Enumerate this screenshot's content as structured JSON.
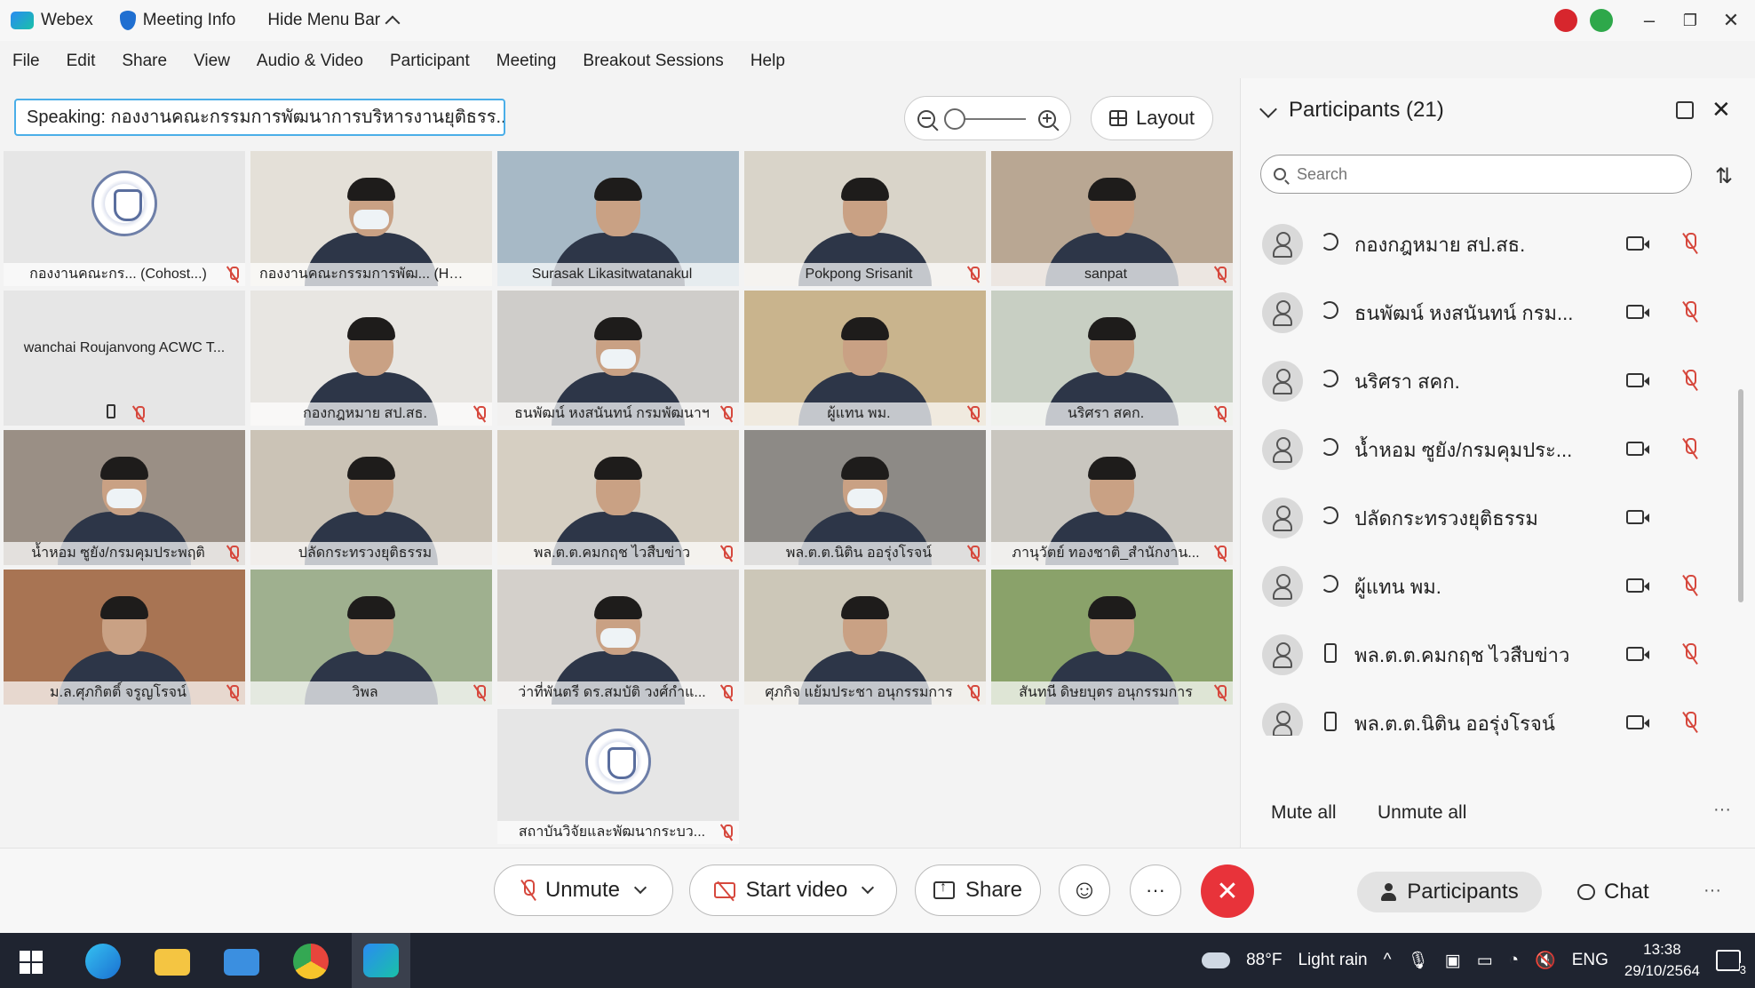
{
  "titlebar": {
    "app_name": "Webex",
    "meeting_info": "Meeting Info",
    "hide_menu": "Hide Menu Bar",
    "status_red_color": "#d7262d",
    "status_green_color": "#2ea84a"
  },
  "menu": [
    "File",
    "Edit",
    "Share",
    "View",
    "Audio & Video",
    "Participant",
    "Meeting",
    "Breakout Sessions",
    "Help"
  ],
  "speaking": "Speaking: กองงานคณะกรรมการพัฒนาการบริหารงานยุติธรร...",
  "zoom_level": 0.05,
  "layout_label": "Layout",
  "tiles": [
    {
      "name": "กองงานคณะกร...   (Cohost...)",
      "type": "seal",
      "muted": true,
      "active": false
    },
    {
      "name": "กองงานคณะกรรมการพัฒ...  (Host)",
      "type": "video",
      "muted": false,
      "active": true,
      "mask": true,
      "bg": "#e4e0d8"
    },
    {
      "name": "Surasak Likasitwatanakul",
      "type": "video",
      "muted": false,
      "active": true,
      "mask": false,
      "bg": "#a7b9c6"
    },
    {
      "name": "Pokpong Srisanit",
      "type": "video",
      "muted": true,
      "active": false,
      "mask": false,
      "bg": "#d9d4c9"
    },
    {
      "name": "sanpat",
      "type": "video",
      "muted": true,
      "active": false,
      "mask": false,
      "bg": "#b9a793"
    },
    {
      "name": "wanchai Roujanvong ACWC T...",
      "type": "text",
      "muted": true,
      "active": false,
      "phone": true
    },
    {
      "name": "กองกฎหมาย สป.สธ.",
      "type": "video",
      "muted": true,
      "active": false,
      "mask": false,
      "bg": "#e8e6e2"
    },
    {
      "name": "ธนพัฒน์ หงสนันทน์ กรมพัฒนาฯ",
      "type": "video",
      "muted": true,
      "active": false,
      "mask": true,
      "bg": "#cfcdca"
    },
    {
      "name": "ผู้แทน พม.",
      "type": "video",
      "muted": true,
      "active": false,
      "mask": false,
      "bg": "#c9b48d"
    },
    {
      "name": "นริศรา สคก.",
      "type": "video",
      "muted": true,
      "active": false,
      "mask": false,
      "bg": "#c8cfc3"
    },
    {
      "name": "น้ำหอม ซูยัง/กรมคุมประพฤติ",
      "type": "video",
      "muted": true,
      "active": false,
      "mask": true,
      "bg": "#9a8f85"
    },
    {
      "name": "ปลัดกระทรวงยุติธรรม",
      "type": "video",
      "muted": false,
      "active": false,
      "mask": false,
      "bg": "#cbc3b6"
    },
    {
      "name": "พล.ต.ต.คมกฤช ไวสืบข่าว",
      "type": "video",
      "muted": true,
      "active": false,
      "mask": false,
      "bg": "#d6cfc2"
    },
    {
      "name": "พล.ต.ต.นิติน ออรุ่งโรจน์",
      "type": "video",
      "muted": true,
      "active": false,
      "mask": true,
      "bg": "#8d8a86"
    },
    {
      "name": "ภานุวัตย์ ทองชาติ_สำนักงาน...",
      "type": "video",
      "muted": true,
      "active": false,
      "mask": false,
      "bg": "#c9c6bf"
    },
    {
      "name": "ม.ล.ศุภกิตติ์ จรูญโรจน์",
      "type": "video",
      "muted": true,
      "active": false,
      "mask": false,
      "bg": "#a87453"
    },
    {
      "name": "วิพล",
      "type": "video",
      "muted": true,
      "active": false,
      "mask": false,
      "bg": "#9fb08f"
    },
    {
      "name": "ว่าที่พันตรี ดร.สมบัติ วงศ์กำแ...",
      "type": "video",
      "muted": true,
      "active": false,
      "mask": true,
      "bg": "#d4d0cb"
    },
    {
      "name": "ศุภกิจ แย้มประชา อนุกรรมการ",
      "type": "video",
      "muted": true,
      "active": false,
      "mask": false,
      "bg": "#ccc7b8"
    },
    {
      "name": "สันทนี ดิษยบุตร อนุกรรมการ",
      "type": "video",
      "muted": true,
      "active": false,
      "mask": false,
      "bg": "#8aa26a"
    },
    {
      "name": "สถาบันวิจัยและพัฒนากระบว...",
      "type": "seal",
      "muted": true,
      "active": false
    }
  ],
  "panel": {
    "title": "Participants (21)",
    "search_placeholder": "Search",
    "mute_all": "Mute all",
    "unmute_all": "Unmute all",
    "more": "···",
    "participants": [
      {
        "name": "กองกฎหมาย สป.สธ.",
        "device": "sync",
        "muted": true
      },
      {
        "name": "ธนพัฒน์ หงสนันทน์ กรม...",
        "device": "sync",
        "muted": true
      },
      {
        "name": "นริศรา สคก.",
        "device": "sync",
        "muted": true
      },
      {
        "name": "น้ำหอม ซูยัง/กรมคุมประ...",
        "device": "sync",
        "muted": true
      },
      {
        "name": "ปลัดกระทรวงยุติธรรม",
        "device": "sync",
        "muted": false
      },
      {
        "name": "ผู้แทน พม.",
        "device": "sync",
        "muted": true
      },
      {
        "name": "พล.ต.ต.คมกฤช ไวสืบข่าว",
        "device": "phone",
        "muted": true
      },
      {
        "name": "พล.ต.ต.นิติน ออรุ่งโรจน์",
        "device": "phone",
        "muted": true
      }
    ]
  },
  "toolbar": {
    "unmute": "Unmute",
    "start_video": "Start video",
    "share": "Share",
    "reactions": "☺",
    "more": "···",
    "end": "✕",
    "participants": "Participants",
    "chat": "Chat",
    "overflow": "···"
  },
  "taskbar": {
    "temperature": "88°F",
    "weather": "Light rain",
    "language": "ENG",
    "time": "13:38",
    "date": "29/10/2564",
    "notifications": "3"
  }
}
